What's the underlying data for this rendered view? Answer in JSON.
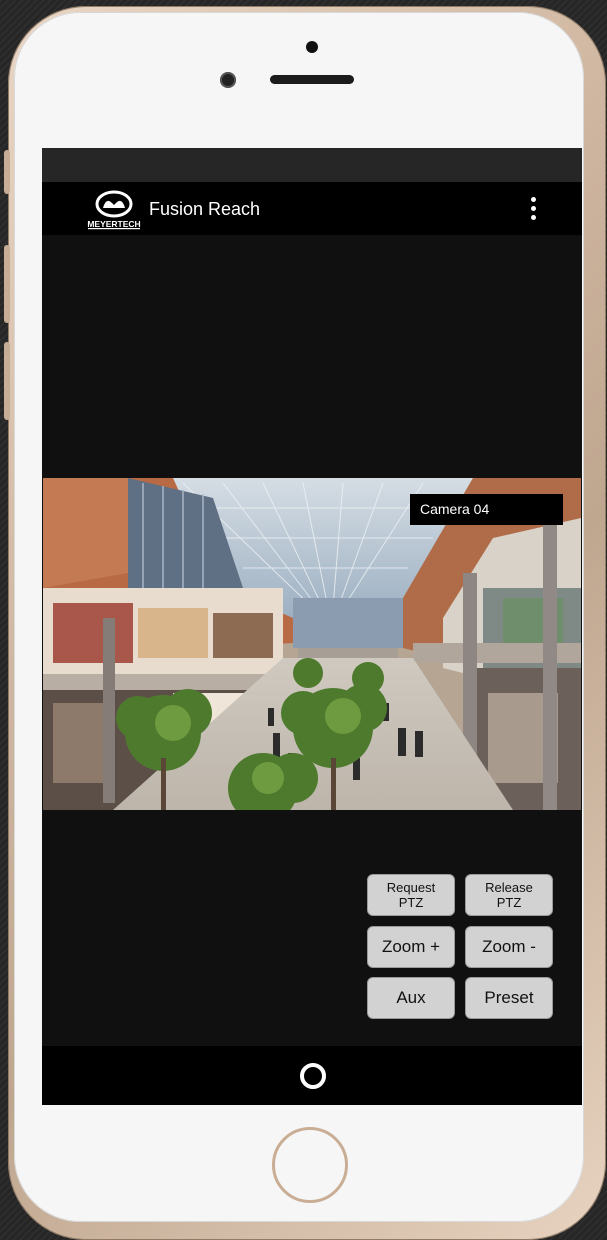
{
  "app": {
    "title": "Fusion Reach",
    "logo_text": "MEYERTECH"
  },
  "video": {
    "camera_label": "Camera 04"
  },
  "ptz_controls": {
    "request_ptz": {
      "line1": "Request",
      "line2": "PTZ"
    },
    "release_ptz": {
      "line1": "Release",
      "line2": "PTZ"
    },
    "zoom_in": "Zoom +",
    "zoom_out": "Zoom -",
    "aux": "Aux",
    "preset": "Preset"
  },
  "icons": {
    "overflow_menu": "more-vertical-icon",
    "nav_home": "home-circle-icon"
  }
}
